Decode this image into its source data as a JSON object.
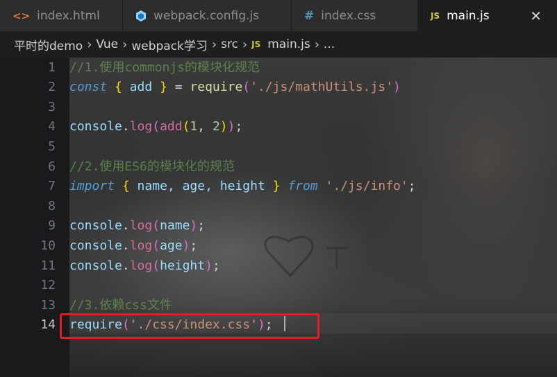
{
  "tabs": [
    {
      "name": "index.html",
      "icon": "html-file-icon"
    },
    {
      "name": "webpack.config.js",
      "icon": "webpack-cube-icon"
    },
    {
      "name": "index.css",
      "icon": "css-hash-icon"
    },
    {
      "name": "main.js",
      "icon": "js-file-icon",
      "active": true
    }
  ],
  "tab_close_glyph": "✕",
  "breadcrumb": {
    "items": [
      "平时的demo",
      "Vue",
      "webpack学习",
      "src",
      "main.js",
      "..."
    ],
    "js_badge": "JS"
  },
  "icons": {
    "html": "<>",
    "css": "#",
    "js": "JS"
  },
  "editor": {
    "line_numbers": [
      "1",
      "2",
      "3",
      "4",
      "5",
      "6",
      "7",
      "8",
      "9",
      "10",
      "11",
      "12",
      "13",
      "14"
    ],
    "current_line": "14",
    "lines": [
      {
        "tokens": [
          {
            "t": "//1.使用commonjs的模块化规范",
            "c": "comment"
          }
        ]
      },
      {
        "tokens": [
          {
            "t": "const",
            "c": "kw"
          },
          {
            "t": " ",
            "c": "punc"
          },
          {
            "t": "{",
            "c": "brace"
          },
          {
            "t": " add ",
            "c": "var"
          },
          {
            "t": "}",
            "c": "brace"
          },
          {
            "t": " = ",
            "c": "punc"
          },
          {
            "t": "require",
            "c": "fn"
          },
          {
            "t": "(",
            "c": "paren"
          },
          {
            "t": "'./js/mathUtils.js'",
            "c": "str"
          },
          {
            "t": ")",
            "c": "paren"
          }
        ]
      },
      {
        "tokens": []
      },
      {
        "tokens": [
          {
            "t": "console",
            "c": "var"
          },
          {
            "t": ".",
            "c": "punc"
          },
          {
            "t": "log",
            "c": "log"
          },
          {
            "t": "(",
            "c": "paren"
          },
          {
            "t": "add",
            "c": "log"
          },
          {
            "t": "(",
            "c": "brace"
          },
          {
            "t": "1",
            "c": "num"
          },
          {
            "t": ", ",
            "c": "punc"
          },
          {
            "t": "2",
            "c": "num"
          },
          {
            "t": ")",
            "c": "brace"
          },
          {
            "t": ")",
            "c": "paren"
          },
          {
            "t": ";",
            "c": "punc"
          }
        ]
      },
      {
        "tokens": []
      },
      {
        "tokens": [
          {
            "t": "//2.使用ES6的模块化的规范",
            "c": "comment"
          }
        ]
      },
      {
        "tokens": [
          {
            "t": "import",
            "c": "kw"
          },
          {
            "t": " ",
            "c": "punc"
          },
          {
            "t": "{",
            "c": "brace"
          },
          {
            "t": " name, age, height ",
            "c": "var"
          },
          {
            "t": "}",
            "c": "brace"
          },
          {
            "t": " ",
            "c": "punc"
          },
          {
            "t": "from",
            "c": "kw"
          },
          {
            "t": " ",
            "c": "punc"
          },
          {
            "t": "'./js/info'",
            "c": "str"
          },
          {
            "t": ";",
            "c": "punc"
          }
        ]
      },
      {
        "tokens": []
      },
      {
        "tokens": [
          {
            "t": "console",
            "c": "var"
          },
          {
            "t": ".",
            "c": "punc"
          },
          {
            "t": "log",
            "c": "log"
          },
          {
            "t": "(",
            "c": "paren"
          },
          {
            "t": "name",
            "c": "var"
          },
          {
            "t": ")",
            "c": "paren"
          },
          {
            "t": ";",
            "c": "punc"
          }
        ]
      },
      {
        "tokens": [
          {
            "t": "console",
            "c": "var"
          },
          {
            "t": ".",
            "c": "punc"
          },
          {
            "t": "log",
            "c": "log"
          },
          {
            "t": "(",
            "c": "paren"
          },
          {
            "t": "age",
            "c": "var"
          },
          {
            "t": ")",
            "c": "paren"
          },
          {
            "t": ";",
            "c": "punc"
          }
        ]
      },
      {
        "tokens": [
          {
            "t": "console",
            "c": "var"
          },
          {
            "t": ".",
            "c": "punc"
          },
          {
            "t": "log",
            "c": "log"
          },
          {
            "t": "(",
            "c": "paren"
          },
          {
            "t": "height",
            "c": "var"
          },
          {
            "t": ")",
            "c": "paren"
          },
          {
            "t": ";",
            "c": "punc"
          }
        ]
      },
      {
        "tokens": []
      },
      {
        "tokens": [
          {
            "t": "//3.依赖css文件",
            "c": "comment"
          }
        ]
      },
      {
        "tokens": [
          {
            "t": "require",
            "c": "var"
          },
          {
            "t": "(",
            "c": "paren"
          },
          {
            "t": "'./css/index.css'",
            "c": "str"
          },
          {
            "t": ")",
            "c": "paren"
          },
          {
            "t": ";",
            "c": "punc"
          }
        ]
      }
    ]
  },
  "colors": {
    "highlight_box": "#e51c23",
    "active_tab_bg": "#1e1e1e",
    "inactive_tab_bg": "#2d2d2d"
  }
}
